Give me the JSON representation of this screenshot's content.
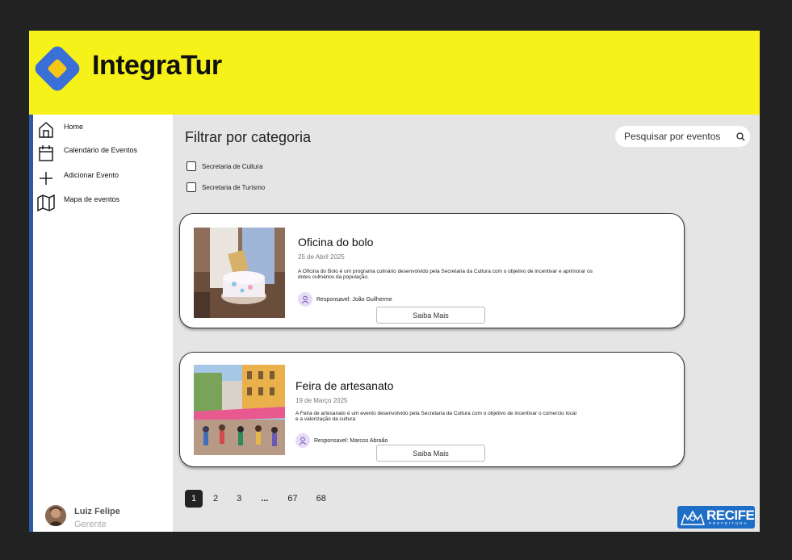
{
  "app": {
    "brand": "IntegraTur",
    "colors": {
      "header": "#f5f119",
      "accent": "#2a5aa6",
      "logo_blue": "#3b6fd8",
      "logo_yellow": "#f5c518"
    }
  },
  "sidebar": {
    "items": [
      {
        "label": "Home",
        "icon": "home-icon"
      },
      {
        "label": "Calendário de Eventos",
        "icon": "calendar-icon"
      },
      {
        "label": "Adicionar Evento",
        "icon": "plus-icon"
      },
      {
        "label": "Mapa de eventos",
        "icon": "map-icon"
      }
    ],
    "user": {
      "name": "Luiz Felipe",
      "role": "Gerente"
    }
  },
  "main": {
    "title": "Filtrar por categoria",
    "search": {
      "placeholder": "Pesquisar por eventos",
      "icon": "search-icon"
    },
    "filters": [
      {
        "label": "Secretaria de Cultura",
        "checked": false
      },
      {
        "label": "Secretaria de Turismo",
        "checked": false
      }
    ],
    "events": [
      {
        "title": "Oficina do bolo",
        "date": "25 de Abril 2025",
        "description": "A Oficina do Bolo é um programa culinário desenvolvido pela Secretaria da Cultura com o objetivo de incentivar e aprimorar os dotes culinários da população.",
        "responsible": "Responsavel: João Guilherme",
        "button": "Saiba Mais"
      },
      {
        "title": "Feira de artesanato",
        "date": "19 de Março 2025",
        "description": "A Feira de artesanato é um evento desenvolvido pela Secretaria da Cultura com o objetivo de incentivar o comercio local e a valorização da cultura",
        "responsible": "Responsavel: Marcos Abraão",
        "button": "Saiba Mais"
      }
    ],
    "pagination": {
      "pages": [
        "1",
        "2",
        "3",
        "...",
        "67",
        "68"
      ],
      "current": "1"
    }
  },
  "footer_logo": {
    "text": "RECIFE",
    "sub": "PREFEITURA"
  }
}
